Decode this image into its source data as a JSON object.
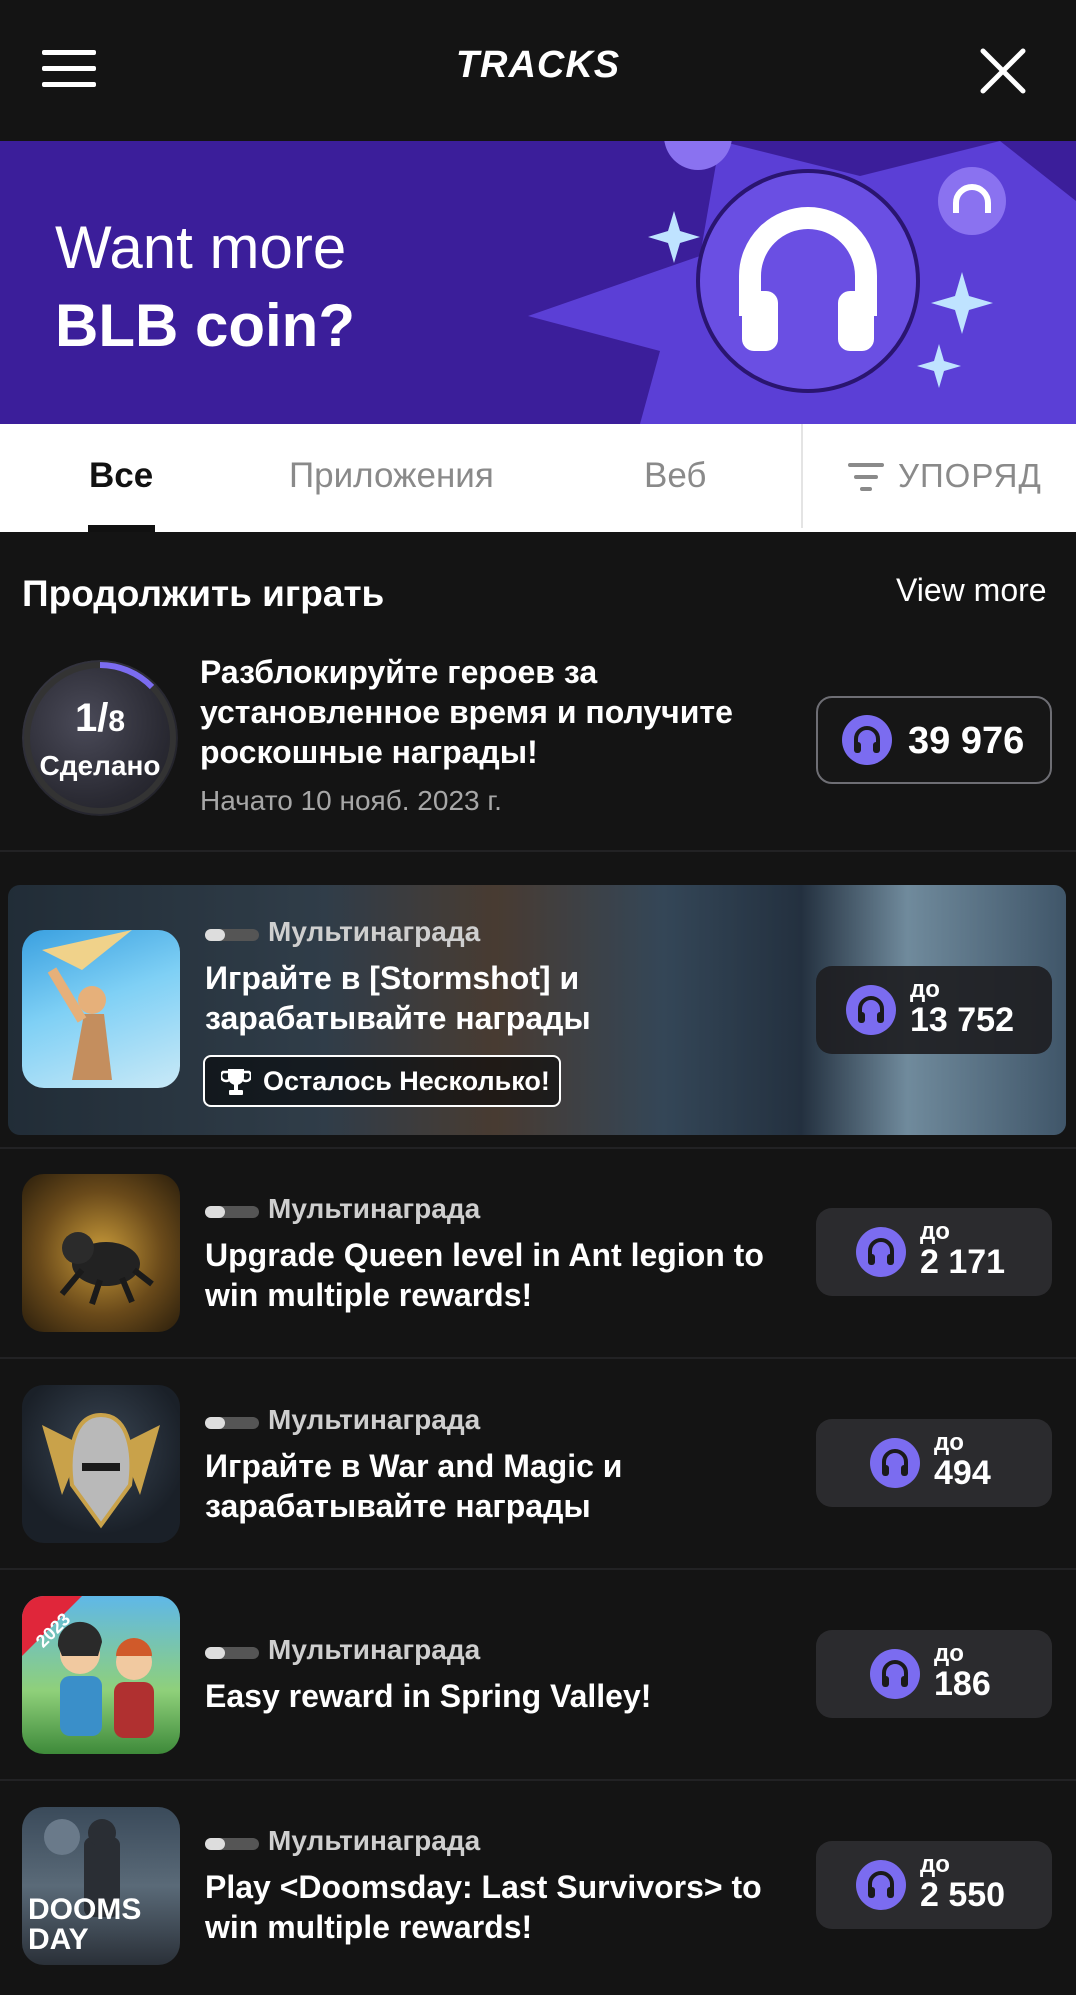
{
  "header": {
    "logo": "TRACKS",
    "menu_icon": "hamburger-icon",
    "close_icon": "close-icon"
  },
  "banner": {
    "line1": "Want more",
    "line2": "BLB coin?",
    "accent": "#3b1e9a"
  },
  "tabs": [
    {
      "label": "Все",
      "active": true
    },
    {
      "label": "Приложения",
      "active": false
    },
    {
      "label": "Веб",
      "active": false
    }
  ],
  "sort": {
    "label": "УПОРЯД",
    "icon": "sort-icon"
  },
  "section": {
    "title": "Продолжить играть",
    "view_more": "View more"
  },
  "continue_item": {
    "progress_current": "1",
    "progress_total": "8",
    "progress_status": "Сделано",
    "title": "Разблокируйте героев за установленное время и получите роскошные награды!",
    "started": "Начато 10 нояб. 2023 г.",
    "reward": "39 976"
  },
  "offers": [
    {
      "tag": "Мультинаграда",
      "title": "Играйте в [Stormshot] и зарабатывайте награды",
      "reward_prefix": "до",
      "reward": "13 752",
      "badge": "Осталось Несколько!"
    },
    {
      "tag": "Мультинаграда",
      "title": "Upgrade Queen level in Ant legion to win multiple rewards!",
      "reward_prefix": "до",
      "reward": "2 171"
    },
    {
      "tag": "Мультинаграда",
      "title": "Играйте в War and Magic и зарабатывайте награды",
      "reward_prefix": "до",
      "reward": "494"
    },
    {
      "tag": "Мультинаграда",
      "title": "Easy reward in Spring Valley!",
      "reward_prefix": "до",
      "reward": "186",
      "icon_badge": "2023"
    },
    {
      "tag": "Мультинаграда",
      "title": "Play <Doomsday: Last Survivors> to win multiple rewards!",
      "reward_prefix": "до",
      "reward": "2 550",
      "icon_text_1": "DOOMS",
      "icon_text_2": "DAY"
    }
  ],
  "colors": {
    "background": "#141414",
    "coin": "#7b6cf0",
    "pill": "#2b2b2e"
  }
}
